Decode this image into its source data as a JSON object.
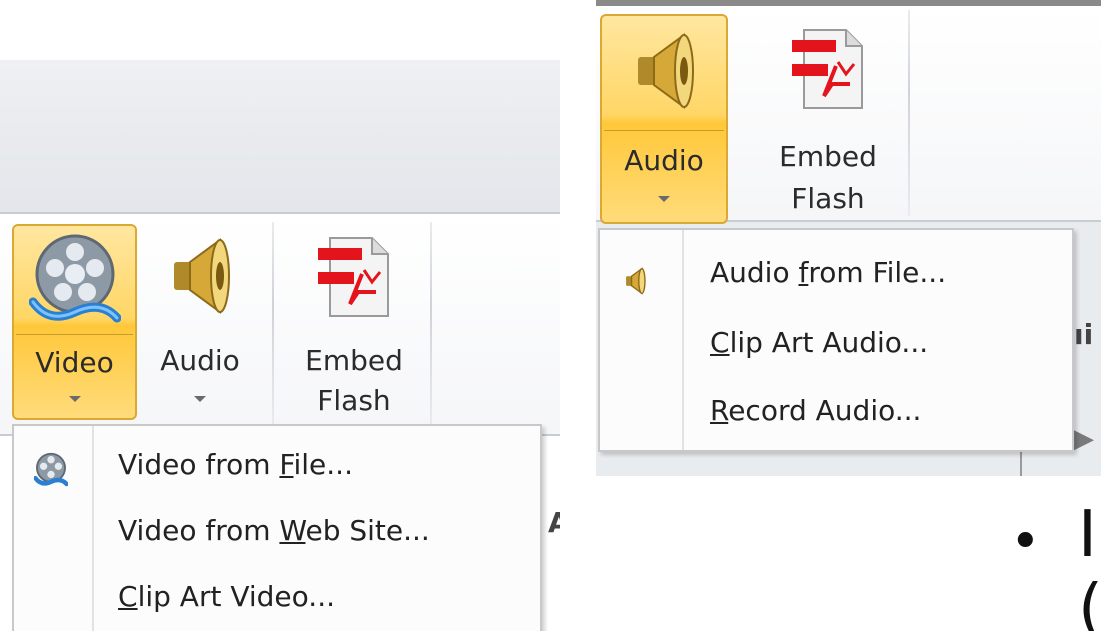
{
  "left_panel": {
    "buttons": [
      {
        "label": "Video",
        "icon": "film-reel-icon",
        "active": true
      },
      {
        "label": "Audio",
        "icon": "speaker-icon",
        "active": false
      },
      {
        "label_line1": "Embed",
        "label_line2": "Flash",
        "icon": "flash-document-icon"
      }
    ],
    "menu": {
      "icon": "film-reel-icon",
      "items": [
        {
          "pre": "Video from ",
          "key": "F",
          "post": "ile..."
        },
        {
          "pre": "Video from ",
          "key": "W",
          "post": "eb Site..."
        },
        {
          "pre": "",
          "key": "C",
          "post": "lip Art Video..."
        }
      ]
    },
    "partial_label": "A"
  },
  "right_panel": {
    "buttons": [
      {
        "label": "Audio",
        "icon": "speaker-icon",
        "active": true
      },
      {
        "label_line1": "Embed",
        "label_line2": "Flash",
        "icon": "flash-document-icon"
      }
    ],
    "menu": {
      "icon": "speaker-icon",
      "items": [
        {
          "pre": "Audio ",
          "key": "f",
          "post": "rom File..."
        },
        {
          "pre": "",
          "key": "C",
          "post": "lip Art Audio..."
        },
        {
          "pre": "",
          "key": "R",
          "post": "ecord Audio..."
        }
      ]
    },
    "partial_label": "ıi",
    "play_arrow": "▶"
  },
  "slide_fragment": {
    "bullet": "•",
    "partial_line1": "I",
    "partial_line2": "("
  },
  "colors": {
    "active_fill": "#ffd666",
    "active_border": "#d9a933",
    "menu_border": "#c8c8c8",
    "ribbon_bg": "#e3e6ea"
  }
}
